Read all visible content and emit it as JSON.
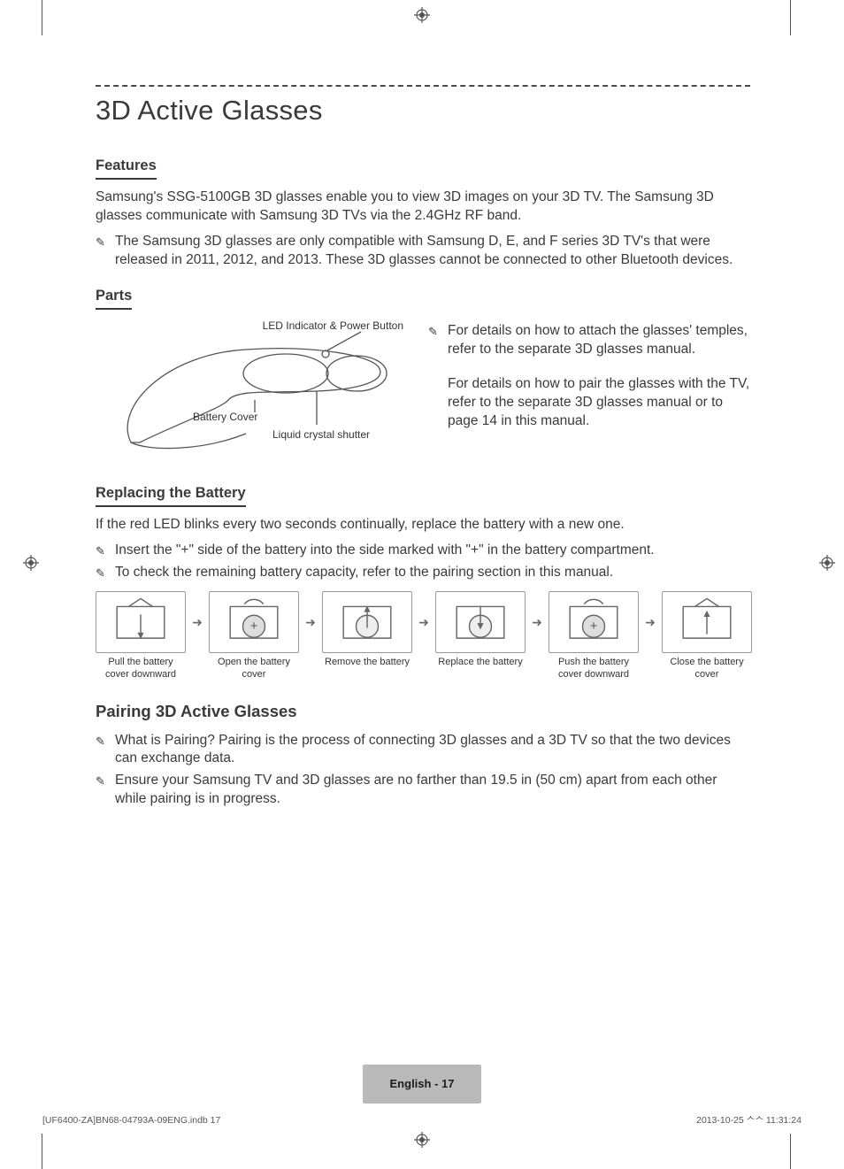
{
  "page": {
    "title": "3D Active Glasses",
    "features": {
      "heading": "Features",
      "intro": "Samsung's SSG-5100GB 3D glasses enable you to view 3D images on your 3D TV. The Samsung 3D glasses communicate with Samsung 3D TVs via the 2.4GHz RF band.",
      "notes": [
        "The Samsung 3D glasses are only compatible with Samsung D, E, and F series 3D TV's that were released in 2011, 2012, and 2013. These 3D glasses cannot be connected to other Bluetooth devices."
      ]
    },
    "parts": {
      "heading": "Parts",
      "labels": {
        "led_power": "LED Indicator & Power Button",
        "battery_cover": "Battery Cover",
        "lcs": "Liquid crystal shutter"
      },
      "side_note": "For details on how to attach the glasses' temples, refer to the separate 3D glasses manual.",
      "side_para": "For details on how to pair the glasses with the TV, refer to the separate 3D glasses manual or to page 14 in this manual."
    },
    "battery": {
      "heading": "Replacing the Battery",
      "intro": "If the red LED blinks every two seconds continually, replace the battery with a new one.",
      "notes": [
        "Insert the \"+\" side of the battery into the side marked with \"+\" in the battery compartment.",
        "To check the remaining battery capacity, refer to the pairing section in this manual."
      ],
      "steps": [
        "Pull the battery cover downward",
        "Open the battery cover",
        "Remove the battery",
        "Replace the battery",
        "Push the battery cover downward",
        "Close the battery cover"
      ]
    },
    "pairing": {
      "heading": "Pairing 3D Active Glasses",
      "notes": [
        "What is Pairing? Pairing is the process of connecting 3D glasses and a 3D TV so that the two devices can exchange data.",
        "Ensure your Samsung TV and 3D glasses are no farther than 19.5 in (50 cm) apart from each other while pairing is in progress."
      ]
    },
    "footer": {
      "pagelabel": "English - 17",
      "slug_left": "[UF6400-ZA]BN68-04793A-09ENG.indb   17",
      "slug_right": "2013-10-25   ᄉᄉ 11:31:24"
    }
  },
  "icons": {
    "note": "note-icon",
    "arrow": "➜",
    "registration": "registration-mark"
  }
}
